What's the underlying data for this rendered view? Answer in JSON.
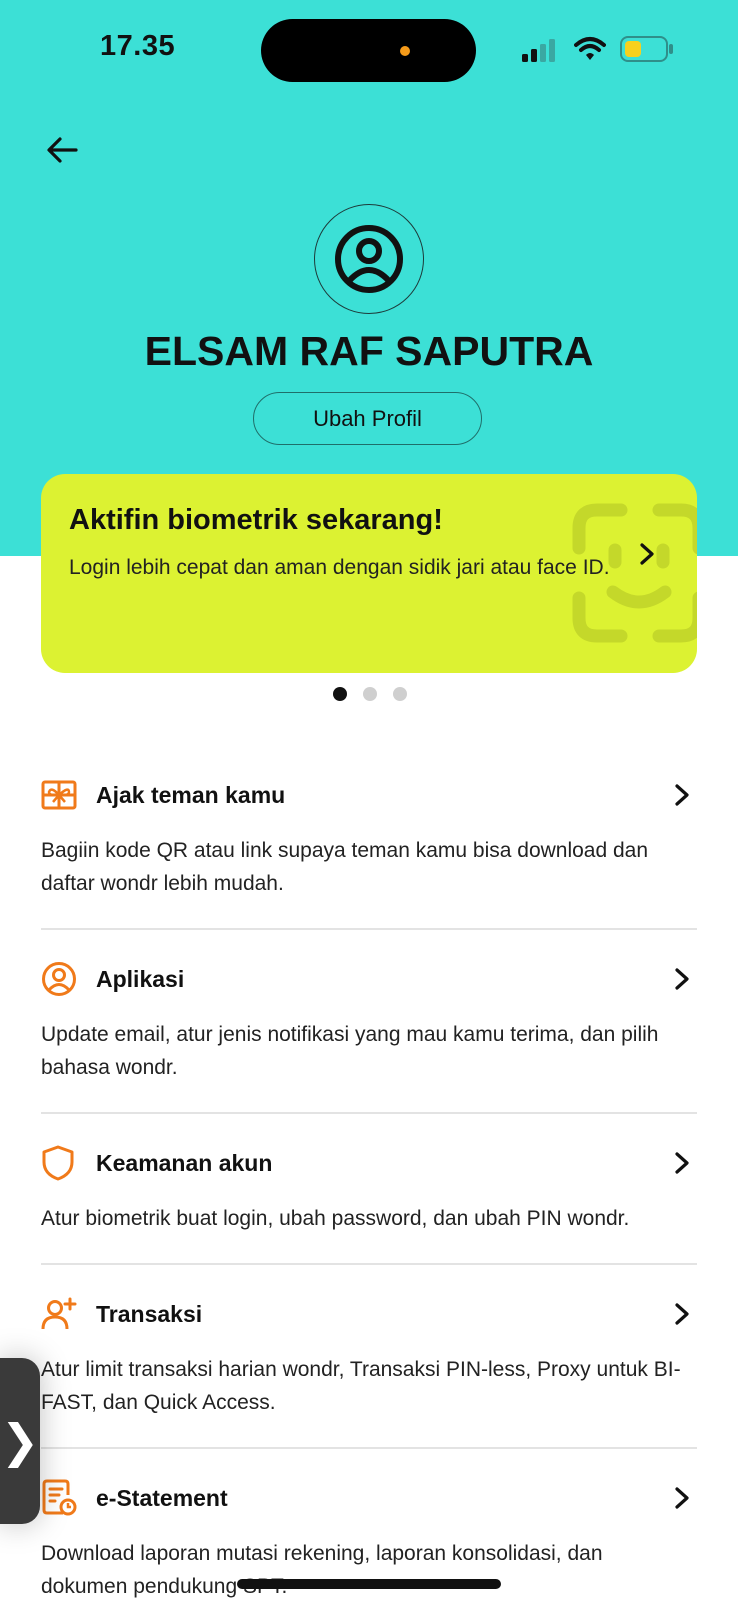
{
  "status_bar": {
    "time": "17.35"
  },
  "colors": {
    "hero": "#3ce0d6",
    "promo": "#dcf232",
    "accent_icon": "#f07a1a"
  },
  "header": {
    "back_icon": "arrow-left-icon",
    "avatar_icon": "user-circle-icon"
  },
  "profile": {
    "name": "ELSAM RAF SAPUTRA",
    "edit_label": "Ubah Profil"
  },
  "promo": {
    "title": "Aktifin biometrik sekarang!",
    "description": "Login lebih cepat dan aman dengan sidik jari atau face ID.",
    "pages": 3,
    "active_page": 1
  },
  "menu": [
    {
      "icon": "gift-card-icon",
      "title": "Ajak teman kamu",
      "description": "Bagiin kode QR atau link supaya teman kamu bisa download dan daftar wondr lebih mudah."
    },
    {
      "icon": "user-circle-icon",
      "title": "Aplikasi",
      "description": "Update email, atur jenis notifikasi yang mau kamu terima, dan pilih bahasa wondr."
    },
    {
      "icon": "shield-icon",
      "title": "Keamanan akun",
      "description": "Atur biometrik buat login, ubah password, dan ubah PIN wondr."
    },
    {
      "icon": "user-plus-icon",
      "title": "Transaksi",
      "description": "Atur limit transaksi harian wondr, Transaksi PIN-less, Proxy untuk BI-FAST, dan Quick Access."
    },
    {
      "icon": "document-clock-icon",
      "title": "e-Statement",
      "description": "Download laporan mutasi rekening, laporan konsolidasi, dan dokumen pendukung SPT."
    }
  ],
  "side_tab": {
    "glyph": "❯"
  }
}
